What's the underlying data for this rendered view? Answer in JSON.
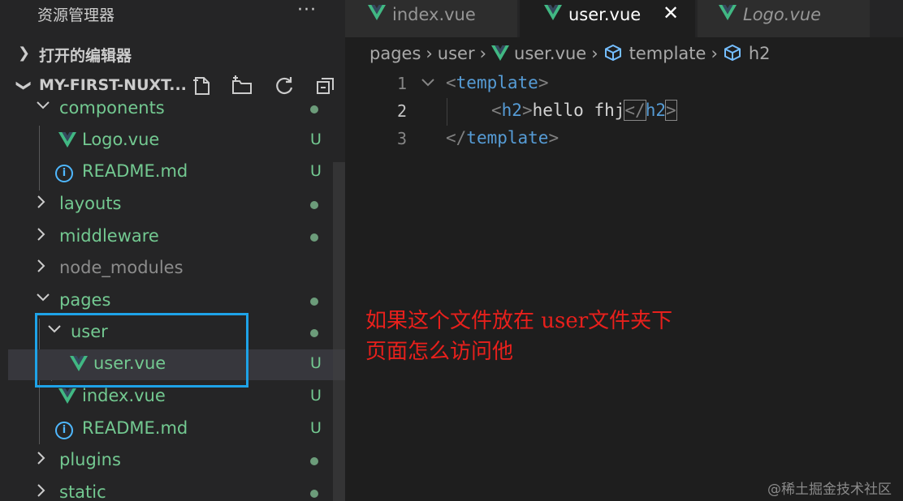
{
  "explorer": {
    "title": "资源管理器",
    "more_label": "···",
    "open_editors_label": "打开的编辑器",
    "project_label": "MY-FIRST-NUXT...",
    "project_icons": [
      "new-file-icon",
      "new-folder-icon",
      "refresh-icon",
      "collapse-all-icon"
    ]
  },
  "tree": [
    {
      "name": "components",
      "type": "folder",
      "expanded": true,
      "status": "dot",
      "color": "#73c991"
    },
    {
      "name": "Logo.vue",
      "type": "vue",
      "status": "U",
      "color": "#73c991"
    },
    {
      "name": "README.md",
      "type": "info",
      "status": "U",
      "color": "#73c991"
    },
    {
      "name": "layouts",
      "type": "folder",
      "expanded": false,
      "status": "dot",
      "color": "#73c991"
    },
    {
      "name": "middleware",
      "type": "folder",
      "expanded": false,
      "status": "dot",
      "color": "#73c991"
    },
    {
      "name": "node_modules",
      "type": "folder",
      "expanded": false,
      "status": "",
      "color": "#8c8c8c"
    },
    {
      "name": "pages",
      "type": "folder",
      "expanded": true,
      "status": "dot",
      "color": "#73c991"
    },
    {
      "name": "user",
      "type": "folder",
      "expanded": true,
      "status": "dot",
      "color": "#73c991"
    },
    {
      "name": "user.vue",
      "type": "vue",
      "status": "U",
      "color": "#73c991"
    },
    {
      "name": "index.vue",
      "type": "vue",
      "status": "U",
      "color": "#73c991"
    },
    {
      "name": "README.md",
      "type": "info",
      "status": "U",
      "color": "#73c991"
    },
    {
      "name": "plugins",
      "type": "folder",
      "expanded": false,
      "status": "dot",
      "color": "#73c991"
    },
    {
      "name": "static",
      "type": "folder",
      "expanded": false,
      "status": "dot",
      "color": "#73c991"
    }
  ],
  "tabs": [
    {
      "label": "index.vue",
      "active": false,
      "italic": false
    },
    {
      "label": "user.vue",
      "active": true,
      "italic": false,
      "close": "✕"
    },
    {
      "label": "Logo.vue",
      "active": false,
      "italic": true
    }
  ],
  "breadcrumb": {
    "parts": [
      "pages",
      "user",
      "user.vue",
      "template",
      "h2"
    ],
    "separator": "›"
  },
  "code": {
    "line_numbers": [
      "1",
      "2",
      "3"
    ],
    "line1": {
      "open": "<",
      "tag": "template",
      "close": ">"
    },
    "line2": {
      "open": "<",
      "tag": "h2",
      "close": ">",
      "text": "hello fhj",
      "end_open": "</",
      "end_tag": "h2",
      "end_close": ">"
    },
    "line3": {
      "open": "</",
      "tag": "template",
      "close": ">"
    }
  },
  "annotation": {
    "line1": "如果这个文件放在 user文件夹下",
    "line2": "页面怎么访问他"
  },
  "watermark": "@稀土掘金技术社区",
  "colors": {
    "vue_green": "#41b883",
    "vue_dark": "#35495e",
    "git_untracked": "#73c991",
    "highlight_box": "#1ea3e8",
    "annotation_red": "#e8201c"
  }
}
